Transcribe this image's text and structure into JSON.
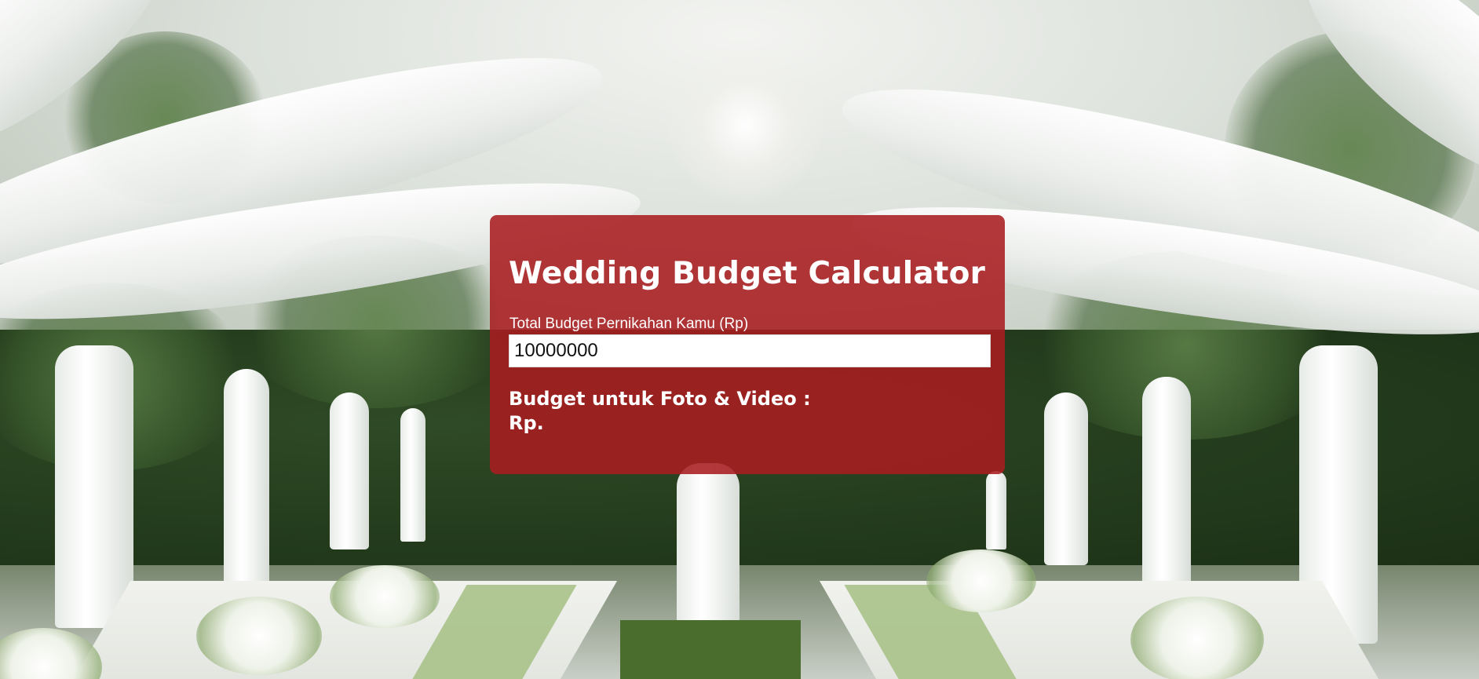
{
  "background": {
    "image": "wedding-tent-reception-photo"
  },
  "calculator": {
    "title": "Wedding Budget Calculator",
    "budget_label": "Total Budget Pernikahan Kamu (Rp)",
    "budget_value": "10000000",
    "result_label": "Budget untuk Foto & Video :",
    "result_value": "Rp.",
    "card_color": "#a81c20"
  }
}
